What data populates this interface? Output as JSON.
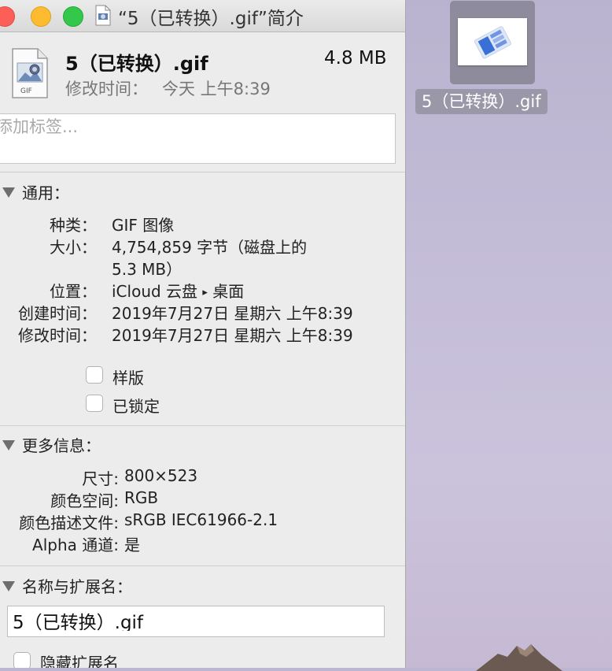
{
  "window": {
    "title": "“5（已转换）.gif”简介"
  },
  "header": {
    "file_name": "5（已转换）.gif",
    "file_size": "4.8 MB",
    "modified_label": "修改时间：",
    "modified_value": "今天 上午8:39",
    "icon_badge": "GIF"
  },
  "tags": {
    "placeholder": "添加标签..."
  },
  "general": {
    "heading": "通用：",
    "kind_label": "种类：",
    "kind_value": "GIF 图像",
    "size_label": "大小：",
    "size_value_line1": "4,754,859 字节（磁盘上的",
    "size_value_line2": "5.3 MB）",
    "where_label": "位置：",
    "where_value_a": "iCloud 云盘",
    "where_arrow": "▸",
    "where_value_b": "桌面",
    "created_label": "创建时间：",
    "created_value": "2019年7月27日 星期六 上午8:39",
    "modified_label": "修改时间：",
    "modified_value": "2019年7月27日 星期六 上午8:39",
    "stationery_label": "样版",
    "stationery_checked": false,
    "locked_label": "已锁定",
    "locked_checked": false
  },
  "more_info": {
    "heading": "更多信息：",
    "dimensions_label": "尺寸:",
    "dimensions_value": "800×523",
    "color_space_label": "颜色空间:",
    "color_space_value": "RGB",
    "color_profile_label": "颜色描述文件:",
    "color_profile_value": "sRGB IEC61966-2.1",
    "alpha_label": "Alpha 通道:",
    "alpha_value": "是"
  },
  "name_ext": {
    "heading": "名称与扩展名：",
    "name_value": "5（已转换）.gif",
    "hide_ext_label": "隐藏扩展名",
    "hide_ext_checked": false
  },
  "desktop": {
    "icon_label": "5（已转换）.gif"
  },
  "colors": {
    "window_bg": "#ececec",
    "close": "#fc5f58",
    "minimize": "#fdbc2f",
    "zoom": "#34c84a",
    "selection": "#8e8b9c"
  }
}
